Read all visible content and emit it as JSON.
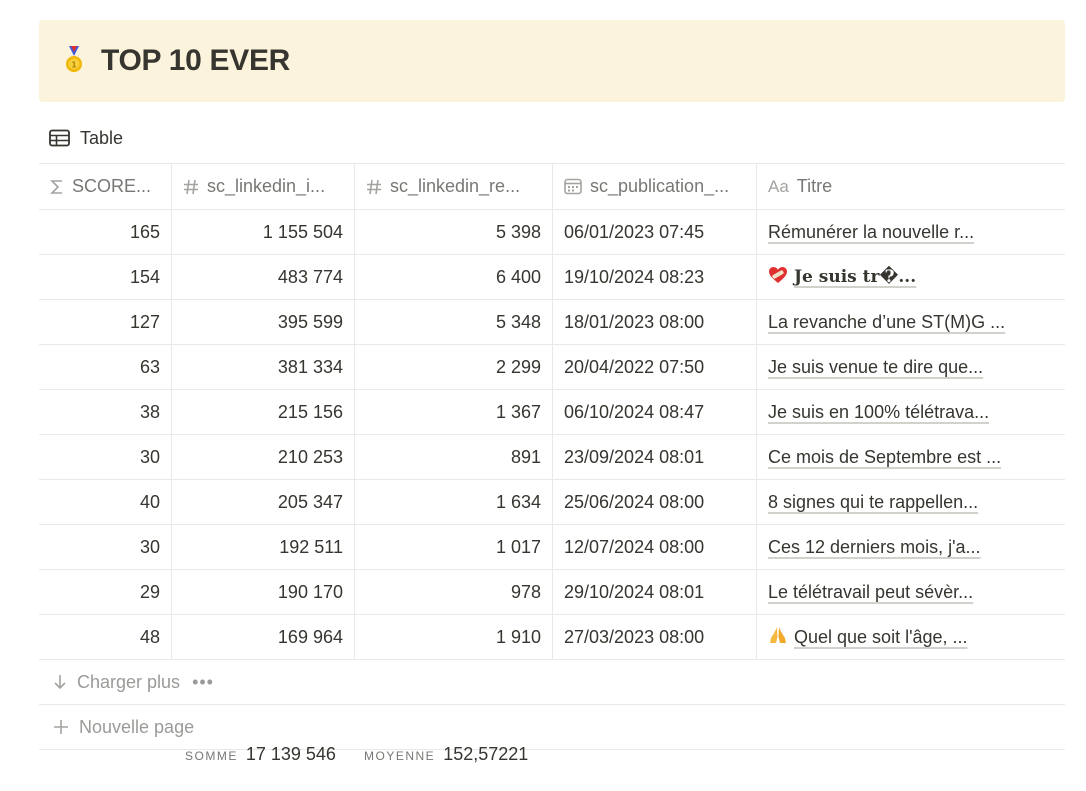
{
  "page": {
    "title": "TOP 10 EVER",
    "title_icon": "medal-icon"
  },
  "view": {
    "label": "Table",
    "icon": "table-icon"
  },
  "columns": [
    {
      "label": "SCORE...",
      "icon": "sigma-icon"
    },
    {
      "label": "sc_linkedin_i...",
      "icon": "number-icon"
    },
    {
      "label": "sc_linkedin_re...",
      "icon": "number-icon"
    },
    {
      "label": "sc_publication_...",
      "icon": "calendar-icon"
    },
    {
      "label": "Titre",
      "icon": "text-icon",
      "icon_text": "Aa"
    }
  ],
  "rows": [
    {
      "score": "165",
      "impressions": "1 155 504",
      "reactions": "5 398",
      "date": "06/01/2023 07:45",
      "title": "Rémunérer la nouvelle r...",
      "emoji": ""
    },
    {
      "score": "154",
      "impressions": "483 774",
      "reactions": "6 400",
      "date": "19/10/2024 08:23",
      "title": "Je suis tr�...",
      "emoji": "heart-bandage-icon"
    },
    {
      "score": "127",
      "impressions": "395 599",
      "reactions": "5 348",
      "date": "18/01/2023 08:00",
      "title": "La revanche d’une ST(M)G ...",
      "emoji": ""
    },
    {
      "score": "63",
      "impressions": "381 334",
      "reactions": "2 299",
      "date": "20/04/2022 07:50",
      "title": "Je suis venue te dire que...",
      "emoji": ""
    },
    {
      "score": "38",
      "impressions": "215 156",
      "reactions": "1 367",
      "date": "06/10/2024 08:47",
      "title": "Je suis en 100% télétrava...",
      "emoji": ""
    },
    {
      "score": "30",
      "impressions": "210 253",
      "reactions": "891",
      "date": "23/09/2024 08:01",
      "title": "Ce mois de Septembre est ...",
      "emoji": ""
    },
    {
      "score": "40",
      "impressions": "205 347",
      "reactions": "1 634",
      "date": "25/06/2024 08:00",
      "title": "8 signes qui te rappellen...",
      "emoji": ""
    },
    {
      "score": "30",
      "impressions": "192 511",
      "reactions": "1 017",
      "date": "12/07/2024 08:00",
      "title": "Ces 12 derniers mois, j'a...",
      "emoji": ""
    },
    {
      "score": "29",
      "impressions": "190 170",
      "reactions": "978",
      "date": "29/10/2024 08:01",
      "title": "Le télétravail peut sévèr...",
      "emoji": ""
    },
    {
      "score": "48",
      "impressions": "169 964",
      "reactions": "1 910",
      "date": "27/03/2023 08:00",
      "title": "Quel que soit l'âge, ...",
      "emoji": "praying-hands-icon"
    }
  ],
  "load_more": {
    "label": "Charger plus",
    "more": "•••"
  },
  "new_page": {
    "label": "Nouvelle page"
  },
  "calculations": [
    {
      "label": "SOMME",
      "value": "17 139 546"
    },
    {
      "label": "MOYENNE",
      "value": "152,57221"
    }
  ],
  "colors": {
    "callout_bg": "#fbf3db",
    "text": "#37352f",
    "muted": "#787774",
    "border": "#e9e9e7"
  }
}
